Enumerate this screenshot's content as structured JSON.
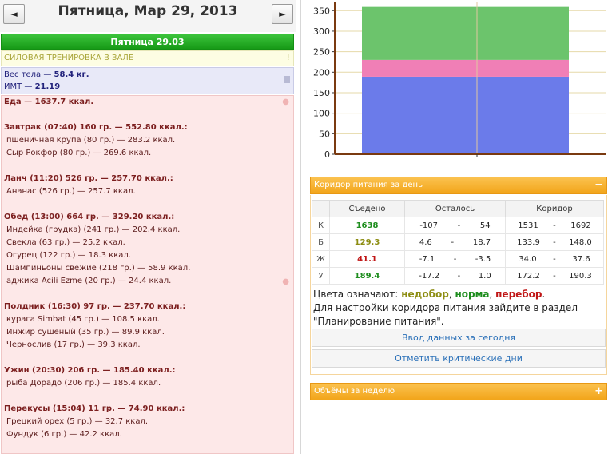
{
  "header": {
    "prev_icon": "◄",
    "next_icon": "►",
    "date_title": "Пятница, Мар 29, 2013"
  },
  "day": {
    "title": "Пятница 29.03"
  },
  "workout": {
    "label": "СИЛОВАЯ ТРЕНИРОВКА В ЗАЛЕ"
  },
  "body": {
    "weight_label": "Вес тела — ",
    "weight": "58.4 кг.",
    "bmi_label": "ИМТ — ",
    "bmi": "21.19"
  },
  "food": {
    "total": "Еда — 1637.7 ккал.",
    "meals": [
      {
        "title": "Завтрак (07:40) 160 гр. — 552.80 ккал.:",
        "items": [
          "пшеничная крупа (80 гр.) — 283.2 ккал.",
          "Сыр Рокфор (80 гр.) — 269.6 ккал."
        ]
      },
      {
        "title": "Ланч (11:20) 526 гр. — 257.70 ккал.:",
        "items": [
          "Ананас (526 гр.) — 257.7 ккал."
        ]
      },
      {
        "title": "Обед (13:00) 664 гр. — 329.20 ккал.:",
        "items": [
          "Индейка (грудка) (241 гр.) — 202.4 ккал.",
          "Свекла (63 гр.) — 25.2 ккал.",
          "Огурец (122 гр.) — 18.3 ккал.",
          "Шампиньоны свежие (218 гр.) — 58.9 ккал.",
          "аджика Acili Ezme (20 гр.) — 24.4 ккал."
        ]
      },
      {
        "title": "Полдник (16:30) 97 гр. — 237.70 ккал.:",
        "items": [
          "курага Simbat (45 гр.) — 108.5 ккал.",
          "Инжир сушеный (35 гр.) — 89.9 ккал.",
          "Чернослив (17 гр.) — 39.3 ккал."
        ]
      },
      {
        "title": "Ужин (20:30) 206 гр. — 185.40 ккал.:",
        "items": [
          "рыба Дорадо (206 гр.) — 185.4 ккал."
        ]
      },
      {
        "title": "Перекусы (15:04) 11 гр. — 74.90 ккал.:",
        "items": [
          "Грецкий орех (5 гр.) — 32.7 ккал.",
          "Фундук (6 гр.) — 42.2 ккал."
        ]
      }
    ]
  },
  "chart_data": {
    "type": "bar",
    "stacked": true,
    "ylim": [
      0,
      370
    ],
    "yticks": [
      "0",
      "50",
      "100",
      "150",
      "200",
      "250",
      "300",
      "350"
    ],
    "segments": [
      {
        "value": 189,
        "color": "#6b7bea"
      },
      {
        "value": 41,
        "color": "#f07fb6"
      },
      {
        "value": 129,
        "color": "#6cc46c"
      }
    ],
    "grid": true
  },
  "corridor": {
    "title": "Коридор питания за день",
    "toggle": "−",
    "headers": {
      "eaten": "Съедено",
      "left": "Осталось",
      "corridor": "Коридор"
    },
    "rows": [
      {
        "label": "К",
        "eaten": "1638",
        "eaten_class": "c-green",
        "left_min": "-107",
        "left_max": "54",
        "c_min": "1531",
        "c_max": "1692"
      },
      {
        "label": "Б",
        "eaten": "129.3",
        "eaten_class": "c-olive",
        "left_min": "4.6",
        "left_max": "18.7",
        "c_min": "133.9",
        "c_max": "148.0"
      },
      {
        "label": "Ж",
        "eaten": "41.1",
        "eaten_class": "c-red",
        "left_min": "-7.1",
        "left_max": "-3.5",
        "c_min": "34.0",
        "c_max": "37.6"
      },
      {
        "label": "У",
        "eaten": "189.4",
        "eaten_class": "c-green",
        "left_min": "-17.2",
        "left_max": "1.0",
        "c_min": "172.2",
        "c_max": "190.3"
      }
    ],
    "dash": "-",
    "legend_prefix": "Цвета означают: ",
    "legend_under": "недобор",
    "legend_norm": "норма",
    "legend_over": "перебор",
    "legend_comma": ", ",
    "legend_end": ".",
    "legend_text2": "Для настройки коридора питания зайдите в раздел \"Планирование питания\".",
    "btn_input": "Ввод данных за сегодня",
    "btn_critical": "Отметить критические дни"
  },
  "volumes": {
    "title": "Объёмы за неделю",
    "toggle": "+"
  }
}
